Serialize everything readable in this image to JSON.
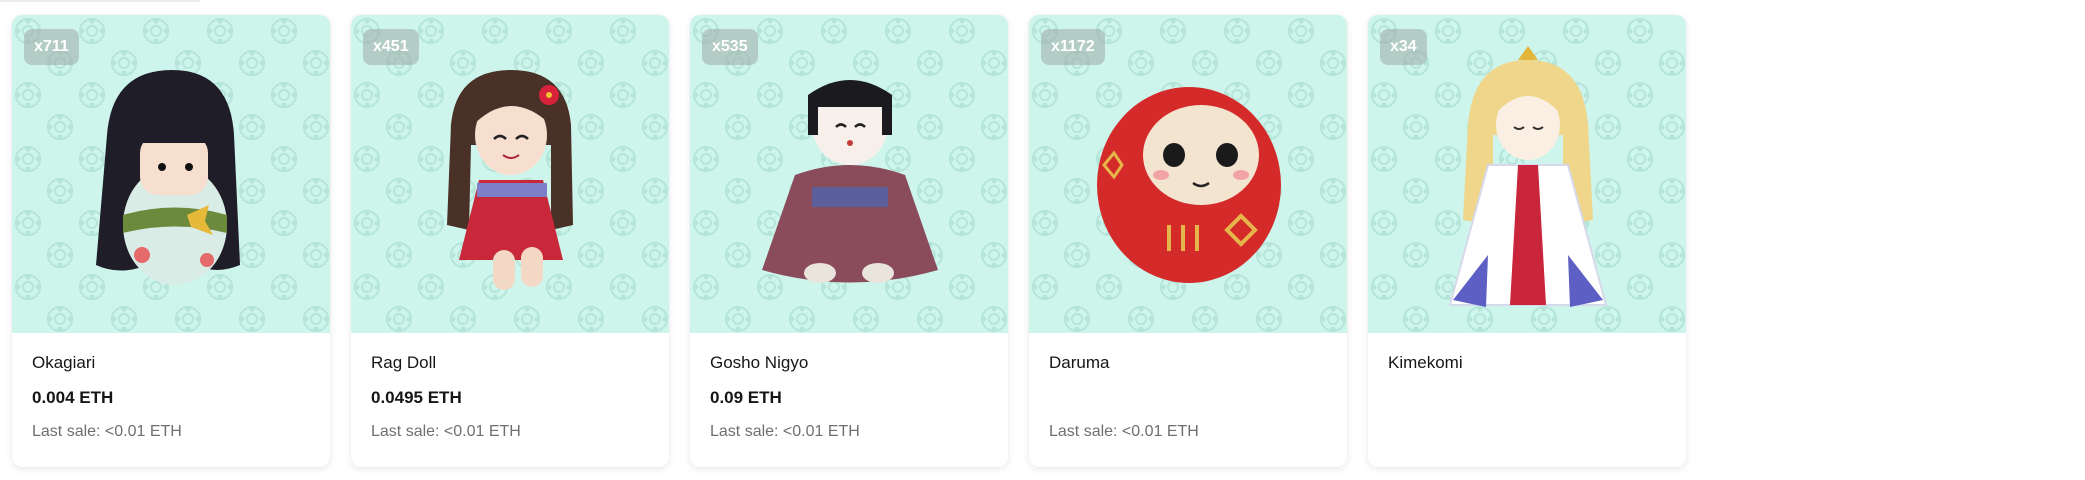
{
  "cards": [
    {
      "count": "x711",
      "name": "Okagiari",
      "price": "0.004 ETH",
      "last_sale": "Last sale: <0.01 ETH",
      "art": "okagiari-doll"
    },
    {
      "count": "x451",
      "name": "Rag Doll",
      "price": "0.0495 ETH",
      "last_sale": "Last sale: <0.01 ETH",
      "art": "rag-doll"
    },
    {
      "count": "x535",
      "name": "Gosho Nigyo",
      "price": "0.09 ETH",
      "last_sale": "Last sale: <0.01 ETH",
      "art": "gosho-nigyo-doll"
    },
    {
      "count": "x1172",
      "name": "Daruma",
      "price": "",
      "last_sale": "Last sale: <0.01 ETH",
      "art": "daruma-doll"
    },
    {
      "count": "x34",
      "name": "Kimekomi",
      "price": "",
      "last_sale": "",
      "art": "kimekomi-doll"
    }
  ],
  "colors": {
    "card_bg": "#cdf5ec",
    "pattern": "#bfe8df"
  }
}
